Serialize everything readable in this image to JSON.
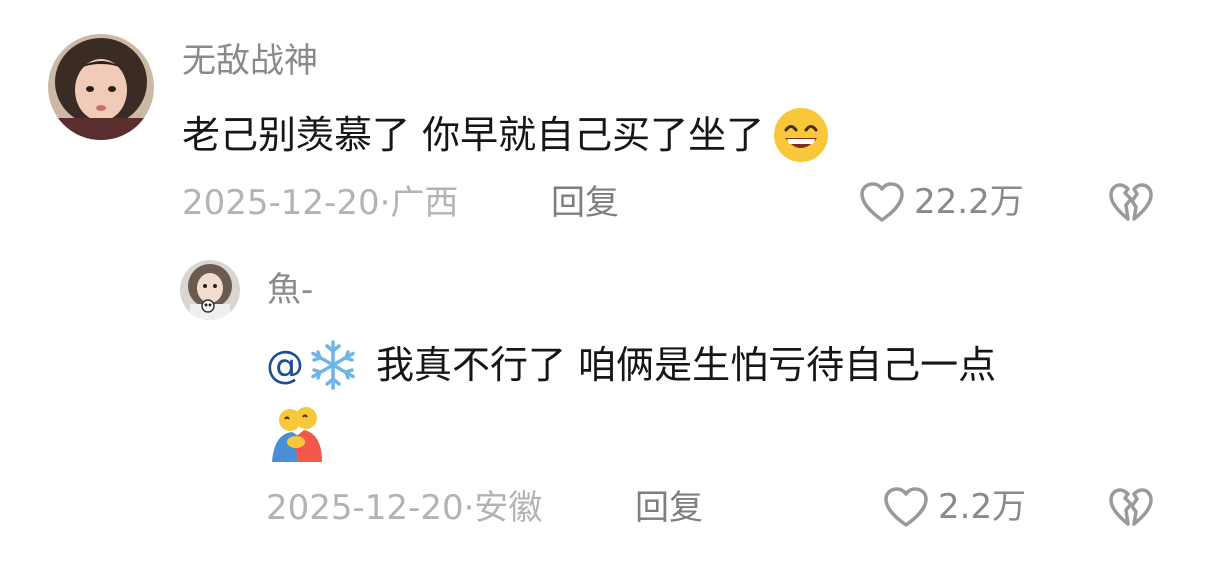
{
  "comments": [
    {
      "username": "无敌战神",
      "text": "老己别羡慕了 你早就自己买了坐了",
      "emoji_icon": "grinning-face-icon",
      "date": "2025-12-20",
      "separator": "·",
      "location": "广西",
      "reply_label": "回复",
      "likes": "22.2万",
      "like_icon": "heart-outline-icon",
      "dislike_icon": "broken-heart-icon"
    },
    {
      "username": "魚-",
      "mention": "@",
      "mention_icon": "snowflake-icon",
      "text": "我真不行了 咱俩是生怕亏待自己一点",
      "emoji_icon": "people-hugging-icon",
      "date": "2025-12-20",
      "separator": "·",
      "location": "安徽",
      "reply_label": "回复",
      "likes": "2.2万",
      "like_icon": "heart-outline-icon",
      "dislike_icon": "broken-heart-icon"
    }
  ],
  "colors": {
    "username": "#8a8a8a",
    "text": "#161616",
    "meta": "#b3b3b3",
    "reply": "#7e7e7e",
    "mention": "#1f4d8f",
    "icon_stroke": "#9a9a9a"
  }
}
